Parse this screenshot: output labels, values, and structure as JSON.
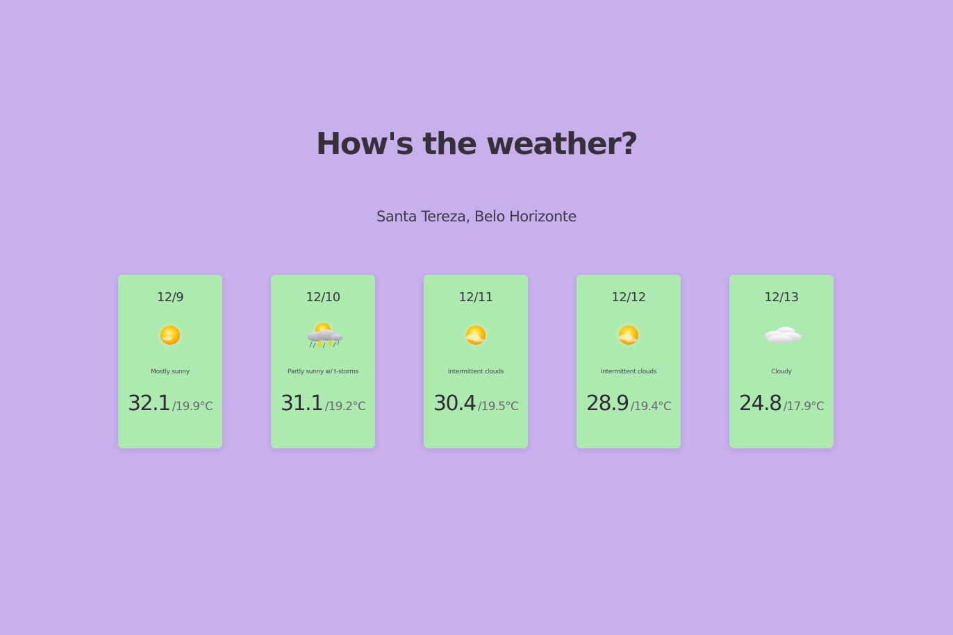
{
  "page": {
    "title": "How's the weather?",
    "location": "Santa Tereza, Belo Horizonte"
  },
  "colors": {
    "background": "#c8b0ed",
    "card": "#adeab0",
    "text": "#35303a"
  },
  "forecast": [
    {
      "date": "12/9",
      "icon": "mostly-sunny-icon",
      "condition": "Mostly sunny",
      "high": "32.1",
      "low": "/19.9°C"
    },
    {
      "date": "12/10",
      "icon": "partly-sunny-tstorms-icon",
      "condition": "Partly sunny w/ t-storms",
      "high": "31.1",
      "low": "/19.2°C"
    },
    {
      "date": "12/11",
      "icon": "intermittent-clouds-icon",
      "condition": "Intermittent clouds",
      "high": "30.4",
      "low": "/19.5°C"
    },
    {
      "date": "12/12",
      "icon": "intermittent-clouds-icon",
      "condition": "Intermittent clouds",
      "high": "28.9",
      "low": "/19.4°C"
    },
    {
      "date": "12/13",
      "icon": "cloudy-icon",
      "condition": "Cloudy",
      "high": "24.8",
      "low": "/17.9°C"
    }
  ]
}
